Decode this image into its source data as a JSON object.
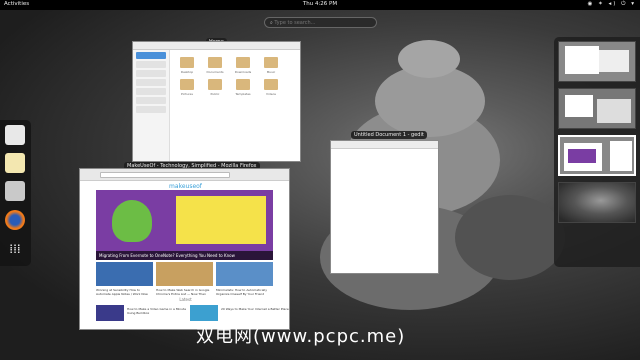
{
  "topbar": {
    "activities": "Activities",
    "clock": "Thu  4:26 PM",
    "tray": "◉ ✶ ◂) ⏻ ▾"
  },
  "search": {
    "placeholder": "Type to search..."
  },
  "dash": {
    "apps": [
      "files",
      "gedit",
      "libreoffice-impress",
      "firefox",
      "show-apps"
    ]
  },
  "windows": {
    "home": {
      "label": "Home",
      "folders": [
        "Desktop",
        "Documents",
        "Downloads",
        "Music",
        "Pictures",
        "Public",
        "Templates",
        "Videos"
      ]
    },
    "gedit": {
      "label": "Untitled Document 1 - gedit"
    },
    "firefox": {
      "label": "MakeUseOf - Technology, Simplified - Mozilla Firefox",
      "site_logo": "makeuseof",
      "hero_caption": "Migrating From Evernote to OneNote? Everything You Need to Know",
      "thumbs": [
        "Winning at Sensibility How to Automate Apple Notes / Work Now",
        "How to Make Web Search in Google Chrome's Entire List — Now Then",
        "Minimalists: How to Automatically Organize Oneself By Your Friend"
      ],
      "latest_label": "Latest",
      "latest": [
        "How to Make a Video Game in a Minute Using Buildbox",
        "20 Ways to Make Your Internet a Better Place"
      ]
    }
  },
  "watermark": "双电网(www.pcpc.me)"
}
